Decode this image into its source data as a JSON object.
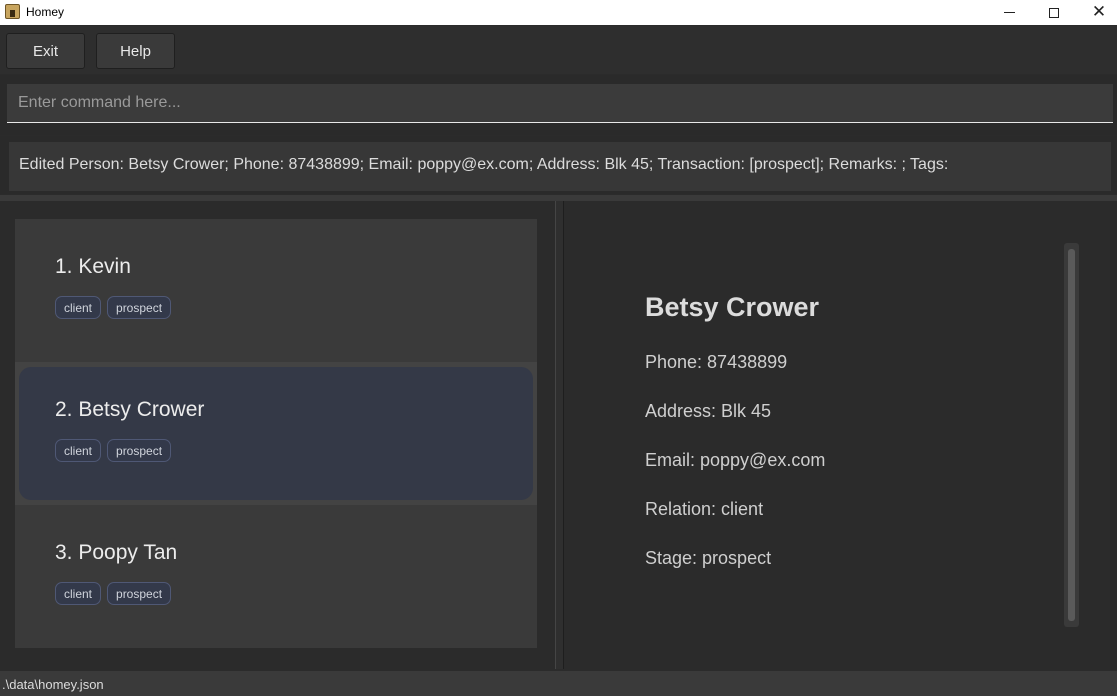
{
  "window": {
    "title": "Homey",
    "minimize_icon": "minimize-icon",
    "maximize_icon": "maximize-icon",
    "close_glyph": "✕"
  },
  "menu": {
    "exit_label": "Exit",
    "help_label": "Help"
  },
  "command": {
    "value": "",
    "placeholder": "Enter command here..."
  },
  "result": {
    "text": "Edited Person: Betsy Crower; Phone: 87438899; Email: poppy@ex.com; Address: Blk 45; Transaction: [prospect]; Remarks: ; Tags:"
  },
  "persons": [
    {
      "index": "1.",
      "name": "Kevin",
      "display": "1.  Kevin",
      "tags": [
        "client",
        "prospect"
      ],
      "selected": false
    },
    {
      "index": "2.",
      "name": "Betsy Crower",
      "display": "2.  Betsy Crower",
      "tags": [
        "client",
        "prospect"
      ],
      "selected": true
    },
    {
      "index": "3.",
      "name": "Poopy Tan",
      "display": "3.  Poopy Tan",
      "tags": [
        "client",
        "prospect"
      ],
      "selected": false
    }
  ],
  "detail": {
    "name": "Betsy Crower",
    "phone": "Phone: 87438899",
    "address": "Address: Blk 45",
    "email": "Email: poppy@ex.com",
    "relation": "Relation: client",
    "stage": "Stage: prospect"
  },
  "status": {
    "path": ".\\data\\homey.json"
  },
  "colors": {
    "background": "#2b2b2b",
    "selected_card": "#343947",
    "tag_bg": "#33394a",
    "tag_border": "#4f5875"
  }
}
